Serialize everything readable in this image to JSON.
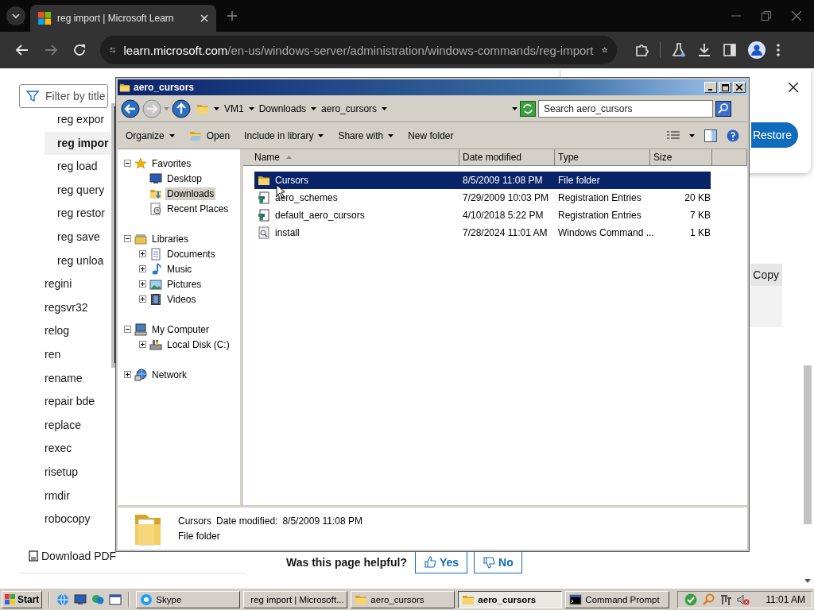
{
  "browser": {
    "tabs": [
      {
        "title": "reg import | Microsoft Learn",
        "selected": true
      }
    ],
    "nav": [
      {
        "kind": "back",
        "disabled": false
      },
      {
        "kind": "forward",
        "disabled": true
      },
      {
        "kind": "reload",
        "disabled": false
      }
    ],
    "url": {
      "host": "learn.microsoft.com",
      "path": "/en-us/windows-server/administration/windows-commands/reg-import"
    }
  },
  "page": {
    "filter": {
      "placeholder": "Filter by title"
    },
    "toc": [
      {
        "children": [
          {
            "label": "reg expor",
            "selected": false
          },
          {
            "label": "reg impor",
            "selected": true
          },
          {
            "label": "reg load",
            "selected": false
          },
          {
            "label": "reg query",
            "selected": false
          },
          {
            "label": "reg restor",
            "selected": false
          },
          {
            "label": "reg save",
            "selected": false
          },
          {
            "label": "reg unloa",
            "selected": false
          }
        ]
      },
      {
        "label": "regini",
        "selected": false
      },
      {
        "label": "regsvr32",
        "selected": false
      },
      {
        "label": "relog",
        "selected": false
      },
      {
        "label": "ren",
        "selected": false
      },
      {
        "label": "rename",
        "selected": false
      },
      {
        "label": "repair bde",
        "selected": false
      },
      {
        "label": "replace",
        "selected": false
      },
      {
        "label": "rexec",
        "selected": false
      },
      {
        "label": "risetup",
        "selected": false
      },
      {
        "label": "rmdir",
        "selected": false
      },
      {
        "label": "robocopy",
        "selected": false
      }
    ],
    "download": "Download PDF",
    "feedback": {
      "question": "Was this page helpful?",
      "buttons": [
        {
          "kind": "like",
          "label": "Yes"
        },
        {
          "kind": "dislike",
          "label": "No"
        }
      ]
    },
    "code_block": {
      "copy": "Copy"
    },
    "dialog": {
      "button": "Restore"
    }
  },
  "explorer": {
    "title": "aero_cursors",
    "breadcrumb": [
      "VM1",
      "Downloads",
      "aero_cursors"
    ],
    "search": {
      "placeholder": "Search aero_cursors"
    },
    "toolbar": [
      {
        "label": "Organize",
        "kind": "menu"
      },
      {
        "label": "Open",
        "kind": "icon"
      },
      {
        "label": "Include in library",
        "kind": "menu"
      },
      {
        "label": "Share with",
        "kind": "menu"
      },
      {
        "label": "New folder",
        "kind": "plain"
      }
    ],
    "tree": [
      {
        "label": "Favorites",
        "kind": "star",
        "selected": false,
        "expanded": true,
        "children": [
          {
            "label": "Desktop",
            "kind": "desktop",
            "selected": false
          },
          {
            "label": "Downloads",
            "kind": "downloads",
            "selected": true
          },
          {
            "label": "Recent Places",
            "kind": "recent",
            "selected": false
          }
        ]
      },
      {
        "label": "Libraries",
        "kind": "library",
        "selected": false,
        "expanded": true,
        "children": [
          {
            "label": "Documents",
            "kind": "documents",
            "selected": false,
            "expanded": false
          },
          {
            "label": "Music",
            "kind": "music",
            "selected": false,
            "expanded": false
          },
          {
            "label": "Pictures",
            "kind": "pictures",
            "selected": false,
            "expanded": false
          },
          {
            "label": "Videos",
            "kind": "videos",
            "selected": false,
            "expanded": false
          }
        ]
      },
      {
        "label": "My Computer",
        "kind": "computer",
        "selected": false,
        "expanded": true,
        "children": [
          {
            "label": "Local Disk (C:)",
            "kind": "disk",
            "selected": false,
            "expanded": false
          }
        ]
      },
      {
        "label": "Network",
        "kind": "network",
        "selected": false,
        "expanded": false
      }
    ],
    "columns": [
      {
        "label": "Name",
        "sorted": true
      },
      {
        "label": "Date modified",
        "sorted": false
      },
      {
        "label": "Type",
        "sorted": false
      },
      {
        "label": "Size",
        "sorted": false
      }
    ],
    "rows": [
      {
        "name": "Cursors",
        "date": "8/5/2009 11:08 PM",
        "type": "File folder",
        "kind": "folder",
        "selected": true
      },
      {
        "name": "aero_schemes",
        "date": "7/29/2009 10:03 PM",
        "type": "Registration Entries",
        "size": "20 KB",
        "kind": "reg",
        "selected": false
      },
      {
        "name": "default_aero_cursors",
        "date": "4/10/2018 5:22 PM",
        "type": "Registration Entries",
        "size": "7 KB",
        "kind": "reg",
        "selected": false
      },
      {
        "name": "install",
        "date": "7/28/2024 11:01 AM",
        "type": "Windows Command ...",
        "size": "1 KB",
        "kind": "cmd",
        "selected": false
      }
    ],
    "details": {
      "name": "Cursors",
      "date_label": "Date modified:",
      "date": "8/5/2009 11:08 PM",
      "type": "File folder"
    }
  },
  "taskbar": {
    "start": "Start",
    "tasks": [
      {
        "label": "Skype",
        "kind": "skype",
        "selected": false
      },
      {
        "label": "reg import | Microsoft...",
        "kind": "browser",
        "selected": false
      },
      {
        "label": "aero_cursors",
        "kind": "folder",
        "selected": false
      },
      {
        "label": "aero_cursors",
        "kind": "folder",
        "selected": true
      },
      {
        "label": "Command Prompt",
        "kind": "console",
        "selected": false
      }
    ],
    "clock": "11:01 AM"
  }
}
